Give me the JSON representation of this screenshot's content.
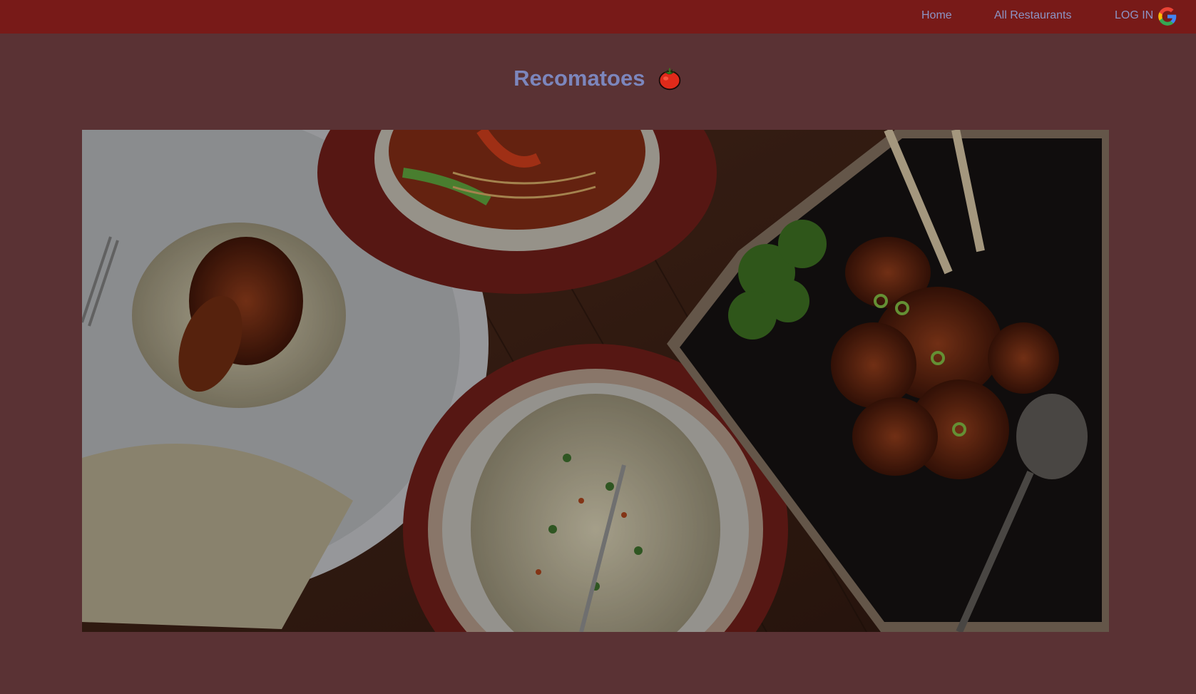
{
  "nav": {
    "home_label": "Home",
    "all_restaurants_label": "All Restaurants",
    "login_label": "LOG IN",
    "login_icon": "google-icon"
  },
  "brand": {
    "title": "Recomatoes",
    "icon": "tomato-icon"
  },
  "hero": {
    "icon": "food-photo"
  },
  "colors": {
    "navbar": "#781a18",
    "page_background": "#5a3234",
    "link": "#8c94c4",
    "title": "#7c86bd"
  }
}
